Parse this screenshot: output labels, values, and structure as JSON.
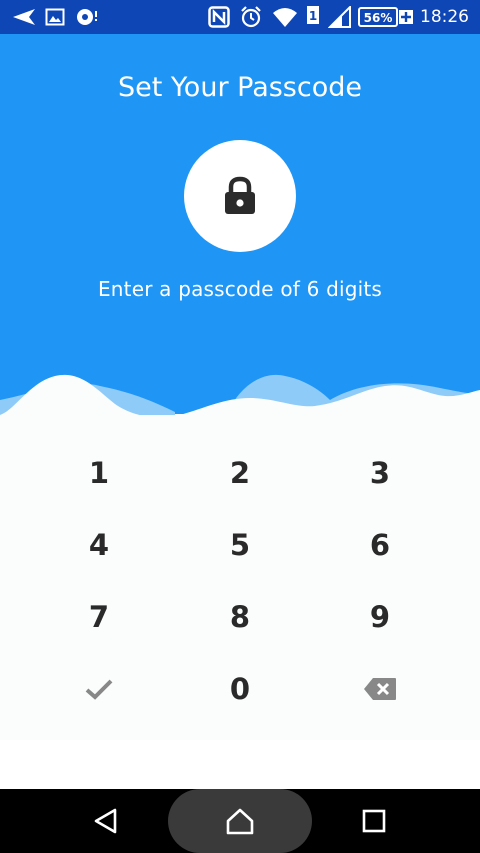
{
  "status_bar": {
    "time": "18:26",
    "battery": "56%",
    "sim_slot": "1",
    "icons": [
      "navigation-icon",
      "image-icon",
      "music-icon",
      "nfc-icon",
      "alarm-icon",
      "wifi-icon",
      "signal-icon",
      "battery-icon"
    ]
  },
  "screen": {
    "title": "Set Your Passcode",
    "subtitle": "Enter a passcode of 6 digits",
    "lock_icon": "lock-icon"
  },
  "keypad": {
    "keys": [
      "1",
      "2",
      "3",
      "4",
      "5",
      "6",
      "7",
      "8",
      "9",
      "0"
    ],
    "confirm_icon": "check-icon",
    "backspace_icon": "backspace-icon"
  },
  "nav_bar": {
    "buttons": [
      "back-icon",
      "home-icon",
      "recents-icon"
    ]
  },
  "colors": {
    "status_bar": "#0f46b5",
    "hero_blue": "#1f96f5",
    "wave_light": "#8fcbf9",
    "keypad_bg": "#fbfdfd",
    "key_text": "#2a2a2a",
    "icon_grey": "#888888",
    "nav_bar": "#000000"
  }
}
